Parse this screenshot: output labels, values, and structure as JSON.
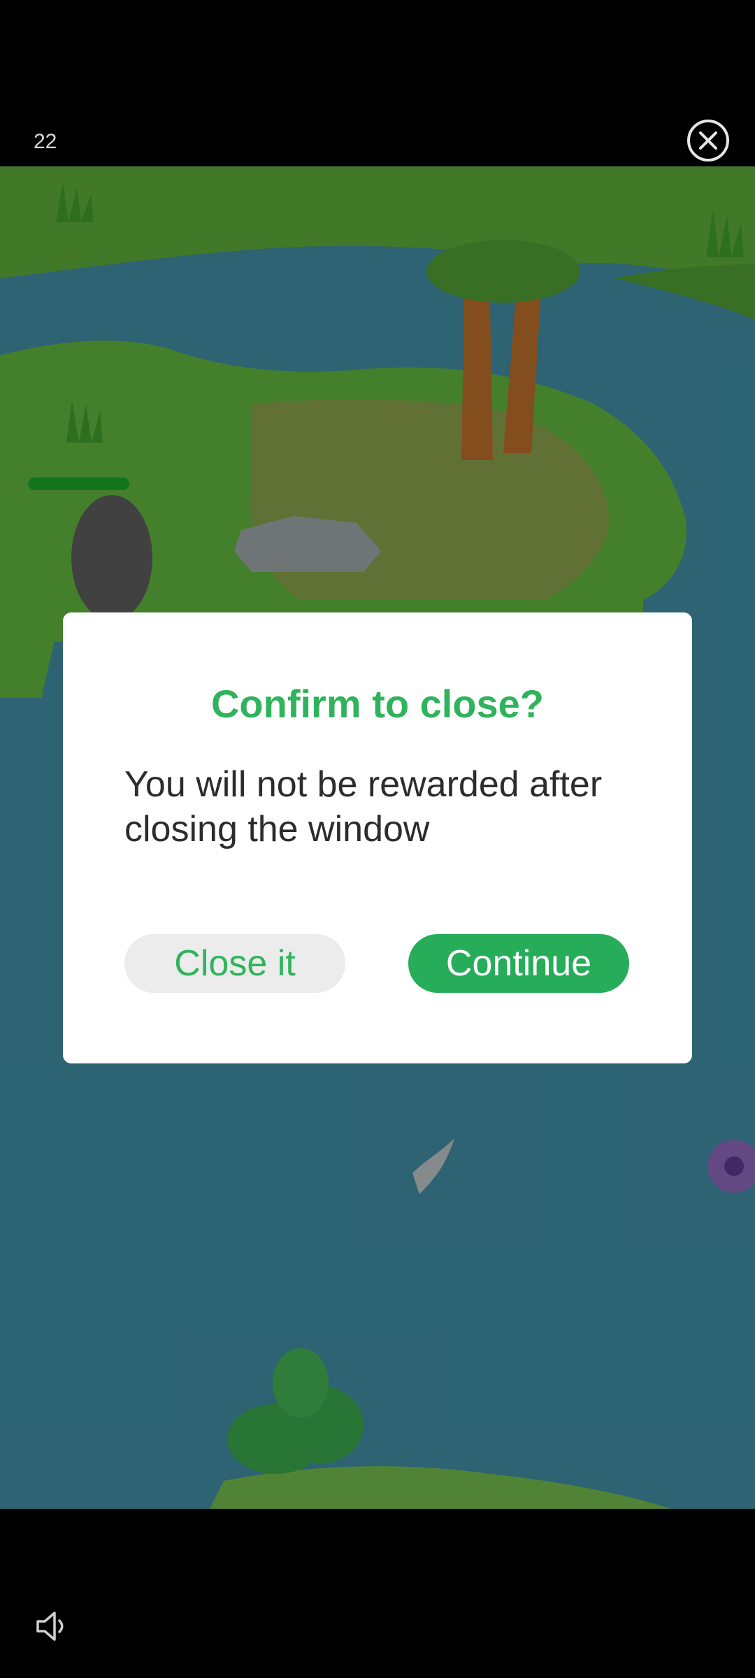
{
  "top_bar": {
    "countdown": "22",
    "close_icon": "close-circle-icon"
  },
  "dialog": {
    "title": "Confirm to close?",
    "message": "You will not be rewarded after closing the window",
    "close_button_label": "Close it",
    "continue_button_label": "Continue"
  },
  "bottom_bar": {
    "sound_icon": "speaker-icon"
  },
  "colors": {
    "accent_green": "#2fb35c",
    "button_green": "#27ac5a",
    "button_gray": "#ececec"
  }
}
